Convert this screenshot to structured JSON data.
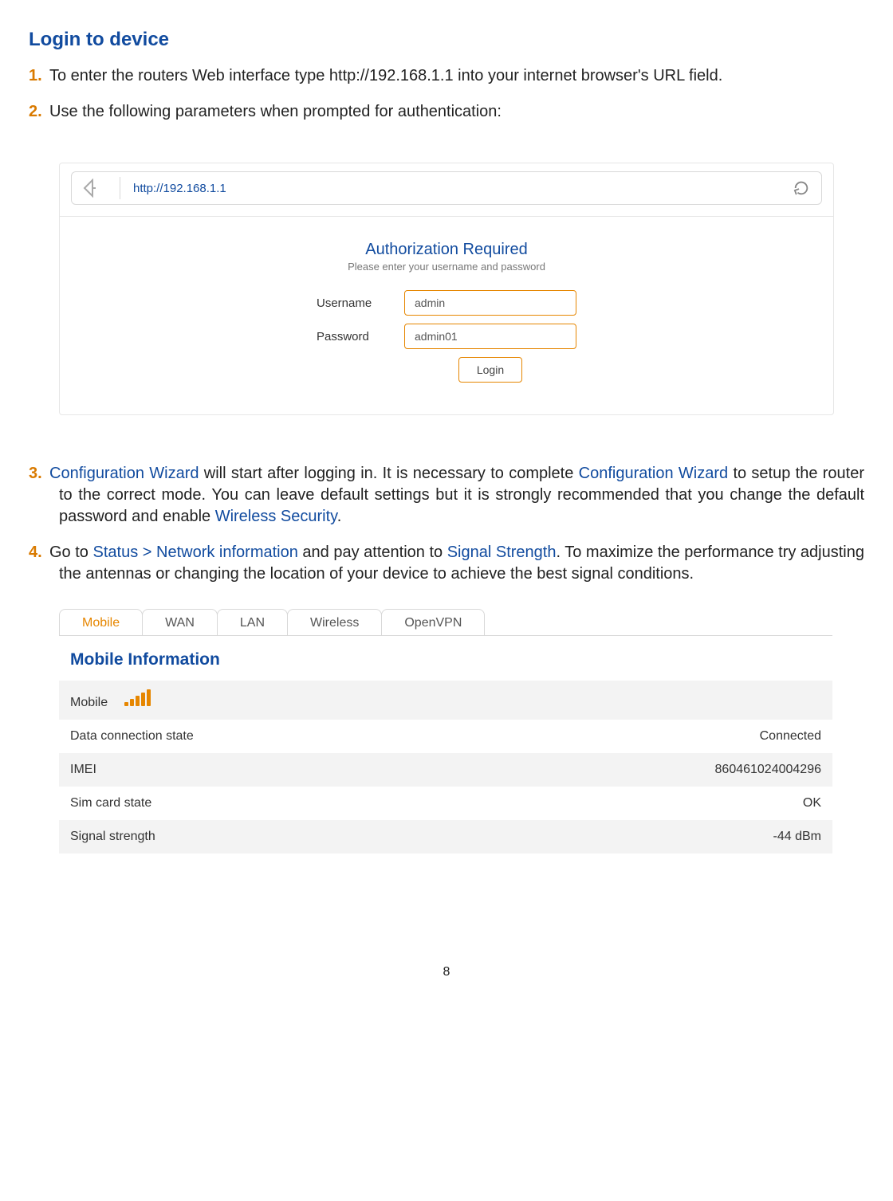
{
  "heading": "Login to device",
  "steps": {
    "s1_num": "1.",
    "s1_text": "To enter the routers Web interface type http://192.168.1.1 into your internet browser's URL field.",
    "s2_num": "2.",
    "s2_text": "Use the following parameters when prompted for authentication:",
    "s3_num": "3.",
    "s3_a": "Configuration Wizard",
    "s3_b": " will start after logging in. It is necessary to complete ",
    "s3_c": "Configuration Wizard",
    "s3_d": " to setup the router to the correct mode. You can leave default settings but it is strongly recommended that you change the default password and enable ",
    "s3_e": "Wireless Security",
    "s3_f": ".",
    "s4_num": "4.",
    "s4_a": "Go to ",
    "s4_b": "Status > Network information",
    "s4_c": " and pay attention to ",
    "s4_d": "Signal Strength",
    "s4_e": ". To maximize the performance try adjusting the antennas or changing the location of your device to achieve the best signal conditions."
  },
  "login": {
    "url": "http://192.168.1.1",
    "title": "Authorization Required",
    "subtitle": "Please enter your username and password",
    "username_label": "Username",
    "username_value": "admin",
    "password_label": "Password",
    "password_value": "admin01",
    "button": "Login"
  },
  "tabs": {
    "mobile": "Mobile",
    "wan": "WAN",
    "lan": "LAN",
    "wireless": "Wireless",
    "openvpn": "OpenVPN"
  },
  "mobile": {
    "panel_title": "Mobile Information",
    "row_mobile": "Mobile",
    "rows": [
      {
        "label": "Data connection state",
        "value": "Connected"
      },
      {
        "label": "IMEI",
        "value": "860461024004296"
      },
      {
        "label": "Sim card state",
        "value": "OK"
      },
      {
        "label": "Signal strength",
        "value": "-44 dBm"
      }
    ]
  },
  "page_number": "8"
}
